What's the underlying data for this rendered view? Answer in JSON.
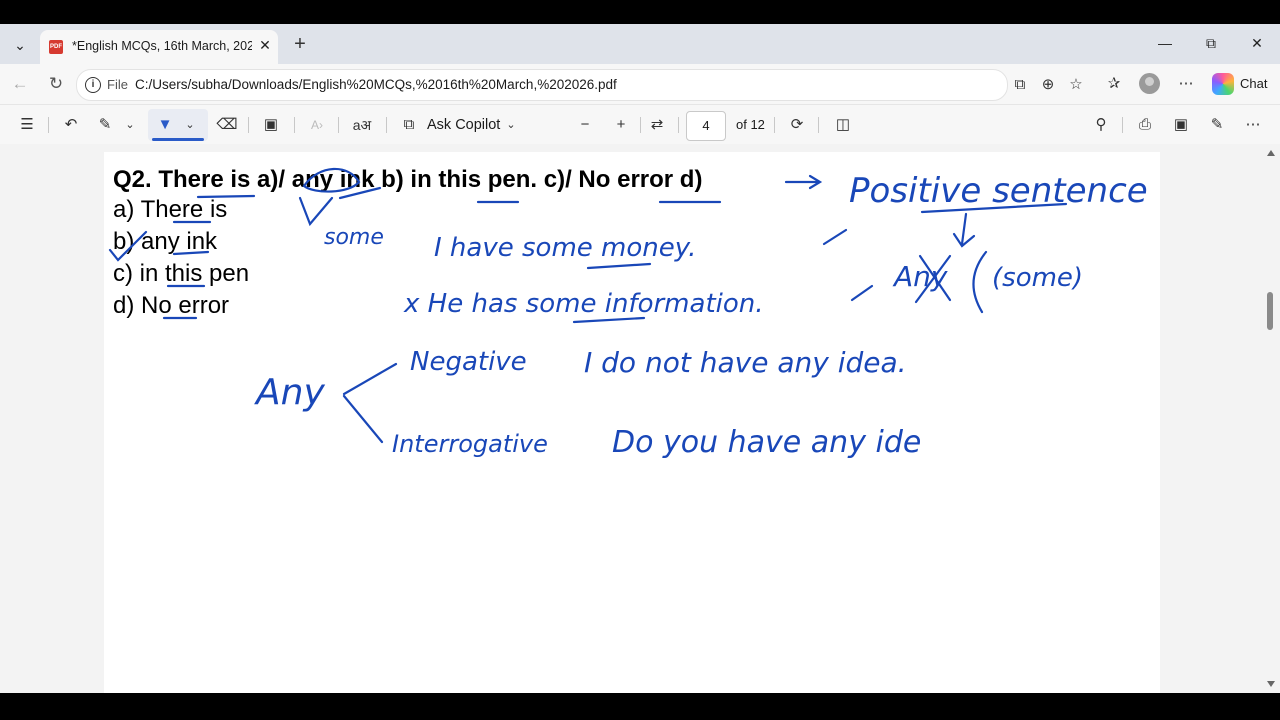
{
  "browser": {
    "tab_title": "*English MCQs, 16th March, 2026.pdf",
    "url_scheme_label": "File",
    "url": "C:/Users/subha/Downloads/English%20MCQs,%2016th%20March,%202026.pdf",
    "chat_label": "Chat"
  },
  "pdf_toolbar": {
    "ask_copilot_label": "Ask Copilot",
    "current_page": "4",
    "total_pages_label": "of 12"
  },
  "document": {
    "question": "Q2. There is a)/ any ink b) in this pen. c)/ No error d)",
    "options": [
      "a) There is",
      "b) any ink",
      "c) in this pen",
      "d) No error"
    ]
  },
  "annotations": {
    "positive": "Positive sentence",
    "some_label": "some",
    "example_1": "I have some money.",
    "example_2": "x He has some information.",
    "any_crossed": "Any",
    "some_paren": "(some)",
    "any_label": "Any",
    "negative_label": "Negative",
    "negative_example": "I do not have any idea.",
    "interrogative_label": "Interrogative",
    "interrogative_example": "Do you have any ide"
  },
  "colors": {
    "ink": "#1947b8",
    "accent": "#2a5bc8"
  }
}
